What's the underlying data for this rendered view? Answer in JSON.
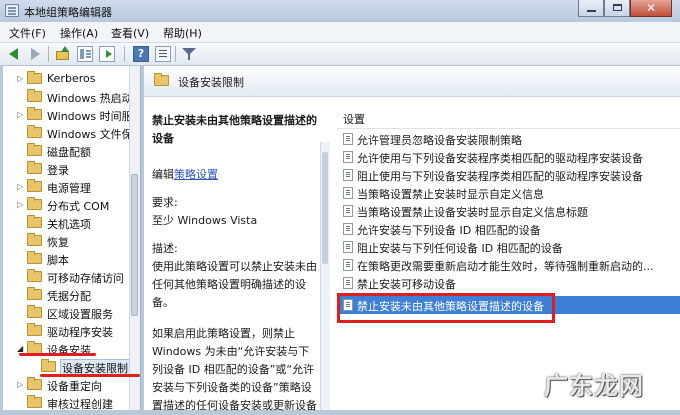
{
  "window": {
    "title": "本地组策略编辑器"
  },
  "menu": [
    "文件(F)",
    "操作(A)",
    "查看(V)",
    "帮助(H)"
  ],
  "tree": {
    "items": [
      {
        "label": "Kerberos",
        "expander": "▷"
      },
      {
        "label": "Windows 热启动",
        "expander": ""
      },
      {
        "label": "Windows 时间服",
        "expander": "▷"
      },
      {
        "label": "Windows 文件保",
        "expander": ""
      },
      {
        "label": "磁盘配额",
        "expander": ""
      },
      {
        "label": "登录",
        "expander": ""
      },
      {
        "label": "电源管理",
        "expander": "▷"
      },
      {
        "label": "分布式 COM",
        "expander": "▷"
      },
      {
        "label": "关机选项",
        "expander": ""
      },
      {
        "label": "恢复",
        "expander": ""
      },
      {
        "label": "脚本",
        "expander": ""
      },
      {
        "label": "可移动存储访问",
        "expander": ""
      },
      {
        "label": "凭据分配",
        "expander": ""
      },
      {
        "label": "区域设置服务",
        "expander": ""
      },
      {
        "label": "驱动程序安装",
        "expander": ""
      },
      {
        "label": "设备安装",
        "expander": "◢"
      },
      {
        "label": "设备安装限制",
        "expander": ""
      },
      {
        "label": "设备重定向",
        "expander": "▷"
      },
      {
        "label": "审核过程创建",
        "expander": ""
      }
    ]
  },
  "panel": {
    "title": "设备安装限制"
  },
  "description": {
    "title": "禁止安装未由其他策略设置描述的设备",
    "edit_prefix": "编辑",
    "edit_link": "策略设置",
    "requirements_label": "要求:",
    "requirements": "至少 Windows Vista",
    "desc_label": "描述:",
    "body": "使用此策略设置可以禁止安装未由任何其他策略设置明确描述的设备。",
    "body2": "如果启用此策略设置，则禁止 Windows 为未由“允许安装与下列设备 ID 相匹配的设备”或“允许安装与下列设备类的设备”策略设置描述的任何设备安装或更新设备"
  },
  "settings": {
    "column_header": "设置",
    "policies": [
      "允许管理员忽略设备安装限制策略",
      "允许使用与下列设备安装程序类相匹配的驱动程序安装设备",
      "阻止使用与下列设备安装程序类相匹配的驱动程序安装设备",
      "当策略设置禁止安装时显示自定义信息",
      "当策略设置禁止设备安装时显示自定义信息标题",
      "允许安装与下列设备 ID 相匹配的设备",
      "阻止安装与下列任何设备 ID 相匹配的设备",
      "在策略更改需要重新启动才能生效时，等待强制重新启动的...",
      "禁止安装可移动设备",
      "禁止安装未由其他策略设置描述的设备"
    ],
    "selected_index": 9
  },
  "watermark": "广东龙网",
  "colors": {
    "annotation": "#e01e1e",
    "selection": "#3d7fd6",
    "link": "#2a56b8"
  },
  "icons": [
    "app-icon",
    "back-arrow-icon",
    "forward-arrow-icon",
    "up-folder-icon",
    "show-tree-icon",
    "export-list-icon",
    "help-icon",
    "properties-icon",
    "filter-icon",
    "folder-icon",
    "policy-setting-icon"
  ]
}
